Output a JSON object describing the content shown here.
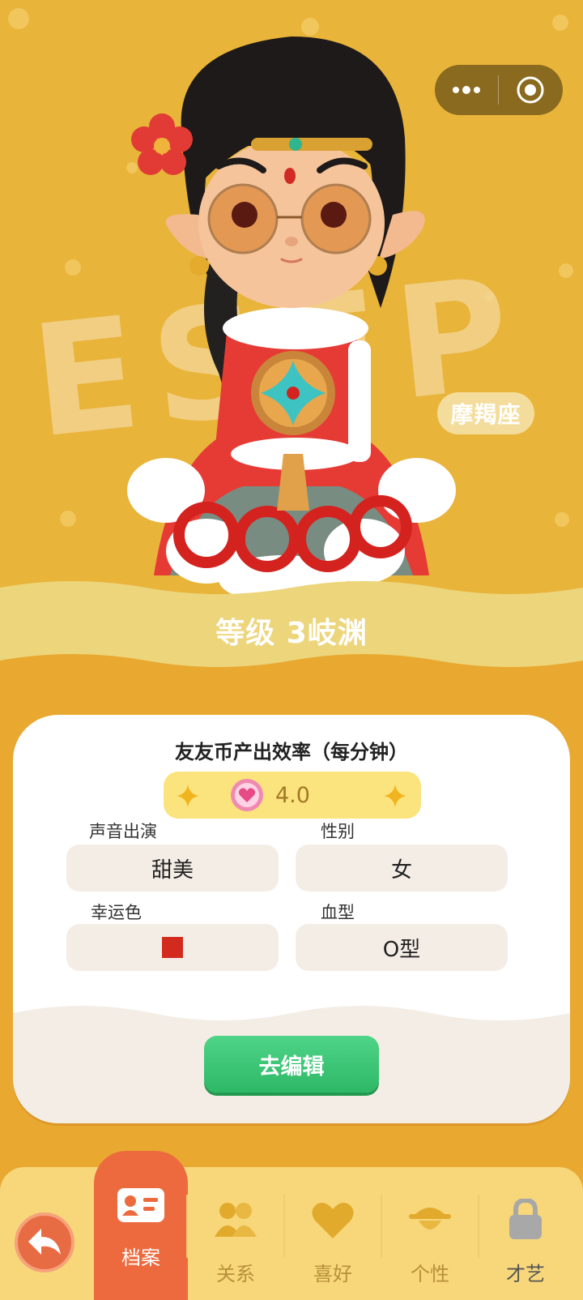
{
  "hero": {
    "mbti": "ESFP",
    "zodiac": "摩羯座",
    "capsule": {
      "more_icon": "more-dots-icon",
      "close_icon": "target-close-icon"
    }
  },
  "level": {
    "label": "等级 3岐渊"
  },
  "card": {
    "efficiency_title": "友友币产出效率（每分钟）",
    "efficiency_value": "4.0",
    "fields": {
      "voice": {
        "label": "声音出演",
        "value": "甜美"
      },
      "gender": {
        "label": "性别",
        "value": "女"
      },
      "lucky_color": {
        "label": "幸运色",
        "color": "#d32a1e"
      },
      "blood": {
        "label": "血型",
        "value": "O型"
      }
    },
    "edit_button": "去编辑"
  },
  "nav": {
    "tabs": [
      {
        "label": "档案",
        "icon": "profile-card-icon",
        "active": true
      },
      {
        "label": "关系",
        "icon": "people-icon"
      },
      {
        "label": "喜好",
        "icon": "heart-icon"
      },
      {
        "label": "个性",
        "icon": "hat-person-icon"
      },
      {
        "label": "才艺",
        "icon": "lock-icon",
        "locked": true
      }
    ]
  },
  "colors": {
    "hero_bg": "#e8b43a",
    "page_bg": "#e9a830",
    "accent_green": "#2db866",
    "active_tab": "#ec6a3e"
  }
}
